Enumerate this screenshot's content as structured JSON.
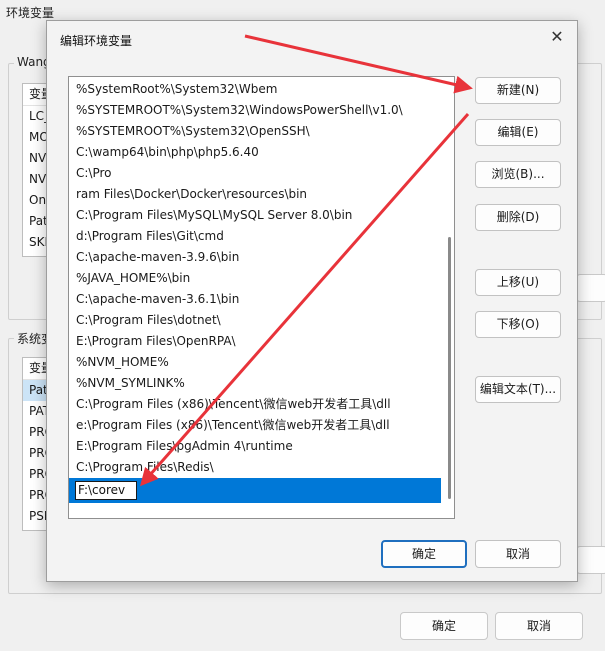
{
  "background_window": {
    "title": "环境变量",
    "user_group_label": "Wang",
    "user_list": {
      "header": "变量",
      "rows": [
        "LC_A",
        "MO",
        "NVI",
        "NVI",
        "One",
        "Path",
        "SKF"
      ]
    },
    "system_group_label": "系统变",
    "system_list": {
      "header": "变量",
      "rows": [
        "Path",
        "PAT",
        "PRO",
        "PRO",
        "PRO",
        "PRO",
        "PSM"
      ]
    },
    "ok_label": "确定",
    "cancel_label": "取消"
  },
  "dialog": {
    "title": "编辑环境变量",
    "close_glyph": "✕",
    "paths": [
      "%SystemRoot%\\System32\\Wbem",
      "%SYSTEMROOT%\\System32\\WindowsPowerShell\\v1.0\\",
      "%SYSTEMROOT%\\System32\\OpenSSH\\",
      "C:\\wamp64\\bin\\php\\php5.6.40",
      "C:\\Pro",
      "ram Files\\Docker\\Docker\\resources\\bin",
      "C:\\Program Files\\MySQL\\MySQL Server 8.0\\bin",
      "d:\\Program Files\\Git\\cmd",
      "C:\\apache-maven-3.9.6\\bin",
      "%JAVA_HOME%\\bin",
      "C:\\apache-maven-3.6.1\\bin",
      "C:\\Program Files\\dotnet\\",
      "E:\\Program Files\\OpenRPA\\",
      "%NVM_HOME%",
      "%NVM_SYMLINK%",
      "C:\\Program Files (x86)\\Tencent\\微信web开发者工具\\dll",
      "e:\\Program Files (x86)\\Tencent\\微信web开发者工具\\dll",
      "E:\\Program Files\\pgAdmin 4\\runtime",
      "C:\\Program Files\\Redis\\"
    ],
    "editing_value": "F:\\corev",
    "buttons": {
      "new": "新建(N)",
      "edit": "编辑(E)",
      "browse": "浏览(B)...",
      "delete": "删除(D)",
      "move_up": "上移(U)",
      "move_down": "下移(O)",
      "edit_text": "编辑文本(T)...",
      "ok": "确定",
      "cancel": "取消"
    },
    "colors": {
      "selection": "#0078d7",
      "annotation_arrow": "#e8333a",
      "primary_border": "#1f6fbf"
    }
  }
}
